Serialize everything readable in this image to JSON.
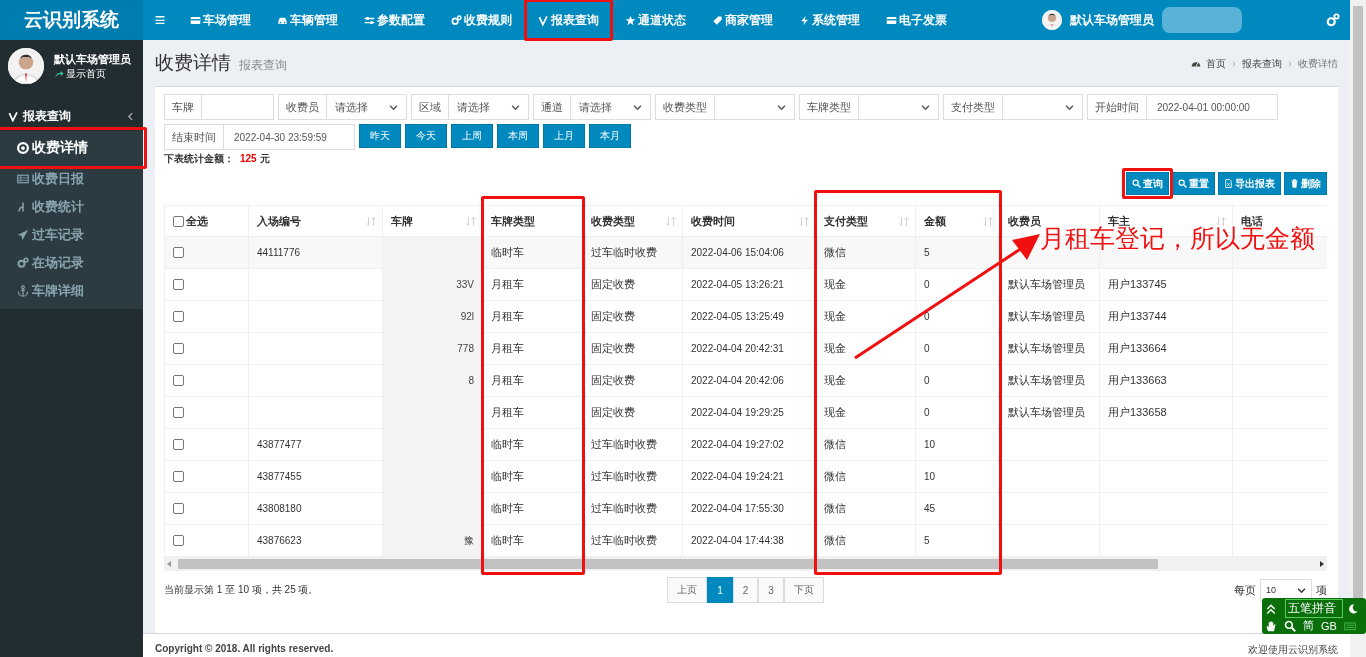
{
  "app": {
    "logo": "云识别系统",
    "menu_glyph": "≡",
    "nav": [
      "车场管理",
      "车辆管理",
      "参数配置",
      "收费规则",
      "报表查询",
      "通道状态",
      "商家管理",
      "系统管理",
      "电子发票"
    ],
    "user": "默认车场管理员"
  },
  "sidebar": {
    "user": "默认车场管理员",
    "status": "显示首页",
    "group": "报表查询",
    "items": [
      {
        "label": "收费详情",
        "selected": true
      },
      {
        "label": "收费日报",
        "selected": false
      },
      {
        "label": "收费统计",
        "selected": false
      },
      {
        "label": "过车记录",
        "selected": false
      },
      {
        "label": "在场记录",
        "selected": false
      },
      {
        "label": "车牌详细",
        "selected": false
      }
    ]
  },
  "page": {
    "title": "收费详情",
    "subtitle": "报表查询",
    "breadcrumb": [
      "首页",
      "报表查询",
      "收费详情"
    ]
  },
  "filters": [
    {
      "label": "车牌",
      "kind": "input"
    },
    {
      "label": "收费员",
      "kind": "select",
      "value": "请选择"
    },
    {
      "label": "区域",
      "kind": "select",
      "value": "请选择"
    },
    {
      "label": "通道",
      "kind": "select",
      "value": "请选择"
    },
    {
      "label": "收费类型",
      "kind": "select"
    },
    {
      "label": "车牌类型",
      "kind": "select"
    },
    {
      "label": "支付类型",
      "kind": "select"
    },
    {
      "label": "开始时间",
      "kind": "input",
      "value": "2022-04-01 00:00:00"
    },
    {
      "label": "结束时间",
      "kind": "input",
      "value": "2022-04-30 23:59:59"
    }
  ],
  "quick_buttons": [
    "昨天",
    "今天",
    "上周",
    "本周",
    "上月",
    "本月"
  ],
  "total": {
    "label": "下表统计金额：",
    "amount": "125",
    "unit": "元"
  },
  "actions": [
    "查询",
    "重置",
    "导出报表",
    "删除"
  ],
  "table": {
    "select_all": {
      "label": "全选",
      "checked": false
    },
    "columns": [
      {
        "label": "入场编号",
        "sortable": true
      },
      {
        "label": "车牌",
        "sortable": true
      },
      {
        "label": "车牌类型",
        "sortable": false
      },
      {
        "label": "收费类型",
        "sortable": true
      },
      {
        "label": "收费时间",
        "sortable": true
      },
      {
        "label": "支付类型",
        "sortable": true
      },
      {
        "label": "金额",
        "sortable": true
      },
      {
        "label": "收费员",
        "sortable": false
      },
      {
        "label": "车主",
        "sortable": true
      },
      {
        "label": "电话"
      }
    ],
    "rows": [
      {
        "checked": false,
        "cells": [
          "44111776",
          "",
          "临时车",
          "过车临时收费",
          "2022-04-06 15:04:06",
          "微信",
          "5",
          "",
          "",
          ""
        ]
      },
      {
        "checked": false,
        "cells": [
          "",
          "33V",
          "月租车",
          "固定收费",
          "2022-04-05 13:26:21",
          "现金",
          "0",
          "默认车场管理员",
          "用户133745",
          ""
        ]
      },
      {
        "checked": false,
        "cells": [
          "",
          "92l",
          "月租车",
          "固定收费",
          "2022-04-05 13:25:49",
          "现金",
          "0",
          "默认车场管理员",
          "用户133744",
          ""
        ]
      },
      {
        "checked": false,
        "cells": [
          "",
          "778",
          "月租车",
          "固定收费",
          "2022-04-04 20:42:31",
          "现金",
          "0",
          "默认车场管理员",
          "用户133664",
          ""
        ]
      },
      {
        "checked": false,
        "cells": [
          "",
          "8",
          "月租车",
          "固定收费",
          "2022-04-04 20:42:06",
          "现金",
          "0",
          "默认车场管理员",
          "用户133663",
          ""
        ]
      },
      {
        "checked": false,
        "cells": [
          "",
          "",
          "月租车",
          "固定收费",
          "2022-04-04 19:29:25",
          "现金",
          "0",
          "默认车场管理员",
          "用户133658",
          ""
        ]
      },
      {
        "checked": false,
        "cells": [
          "43877477",
          "",
          "临时车",
          "过车临时收费",
          "2022-04-04 19:27:02",
          "微信",
          "10",
          "",
          "",
          ""
        ]
      },
      {
        "checked": false,
        "cells": [
          "43877455",
          "",
          "临时车",
          "过车临时收费",
          "2022-04-04 19:24:21",
          "微信",
          "10",
          "",
          "",
          ""
        ]
      },
      {
        "checked": false,
        "cells": [
          "43808180",
          "",
          "临时车",
          "过车临时收费",
          "2022-04-04 17:55:30",
          "微信",
          "45",
          "",
          "",
          ""
        ]
      },
      {
        "checked": false,
        "cells": [
          "43876623",
          "豫",
          "临时车",
          "过车临时收费",
          "2022-04-04 17:44:38",
          "微信",
          "5",
          "",
          "",
          ""
        ]
      }
    ]
  },
  "pagination": {
    "summary": "当前显示第 1 至 10 项，共 25 项。",
    "prev": "上页",
    "next": "下页",
    "pages": [
      {
        "label": "1",
        "selected": true
      },
      {
        "label": "2",
        "selected": false
      },
      {
        "label": "3",
        "selected": false
      }
    ],
    "per_page_label": "每页",
    "per_page": "10",
    "per_page_unit": "项"
  },
  "footer": {
    "copyright": "Copyright © 2018. All rights reserved.",
    "welcome": "欢迎使用云识别系统"
  },
  "ime": {
    "mode": "五笔拼音",
    "script": "简",
    "charset": "GB"
  },
  "annotations": [
    {
      "kind": "box"
    },
    {
      "kind": "box"
    },
    {
      "kind": "box"
    },
    {
      "kind": "box"
    },
    {
      "kind": "box"
    },
    {
      "kind": "arrow"
    },
    {
      "kind": "note",
      "text": "月租车登记，所以无金额"
    }
  ]
}
